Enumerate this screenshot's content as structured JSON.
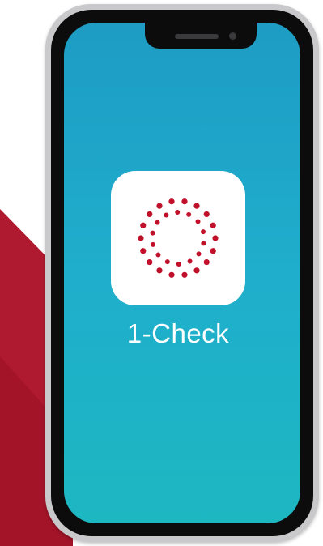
{
  "app": {
    "label": "1-Check",
    "icon": "dotted-ring-icon"
  },
  "colors": {
    "screen_top": "#1e9cc4",
    "screen_bottom": "#1db7c1",
    "accent_red": "#b01a30",
    "dot_red": "#c0102a"
  }
}
